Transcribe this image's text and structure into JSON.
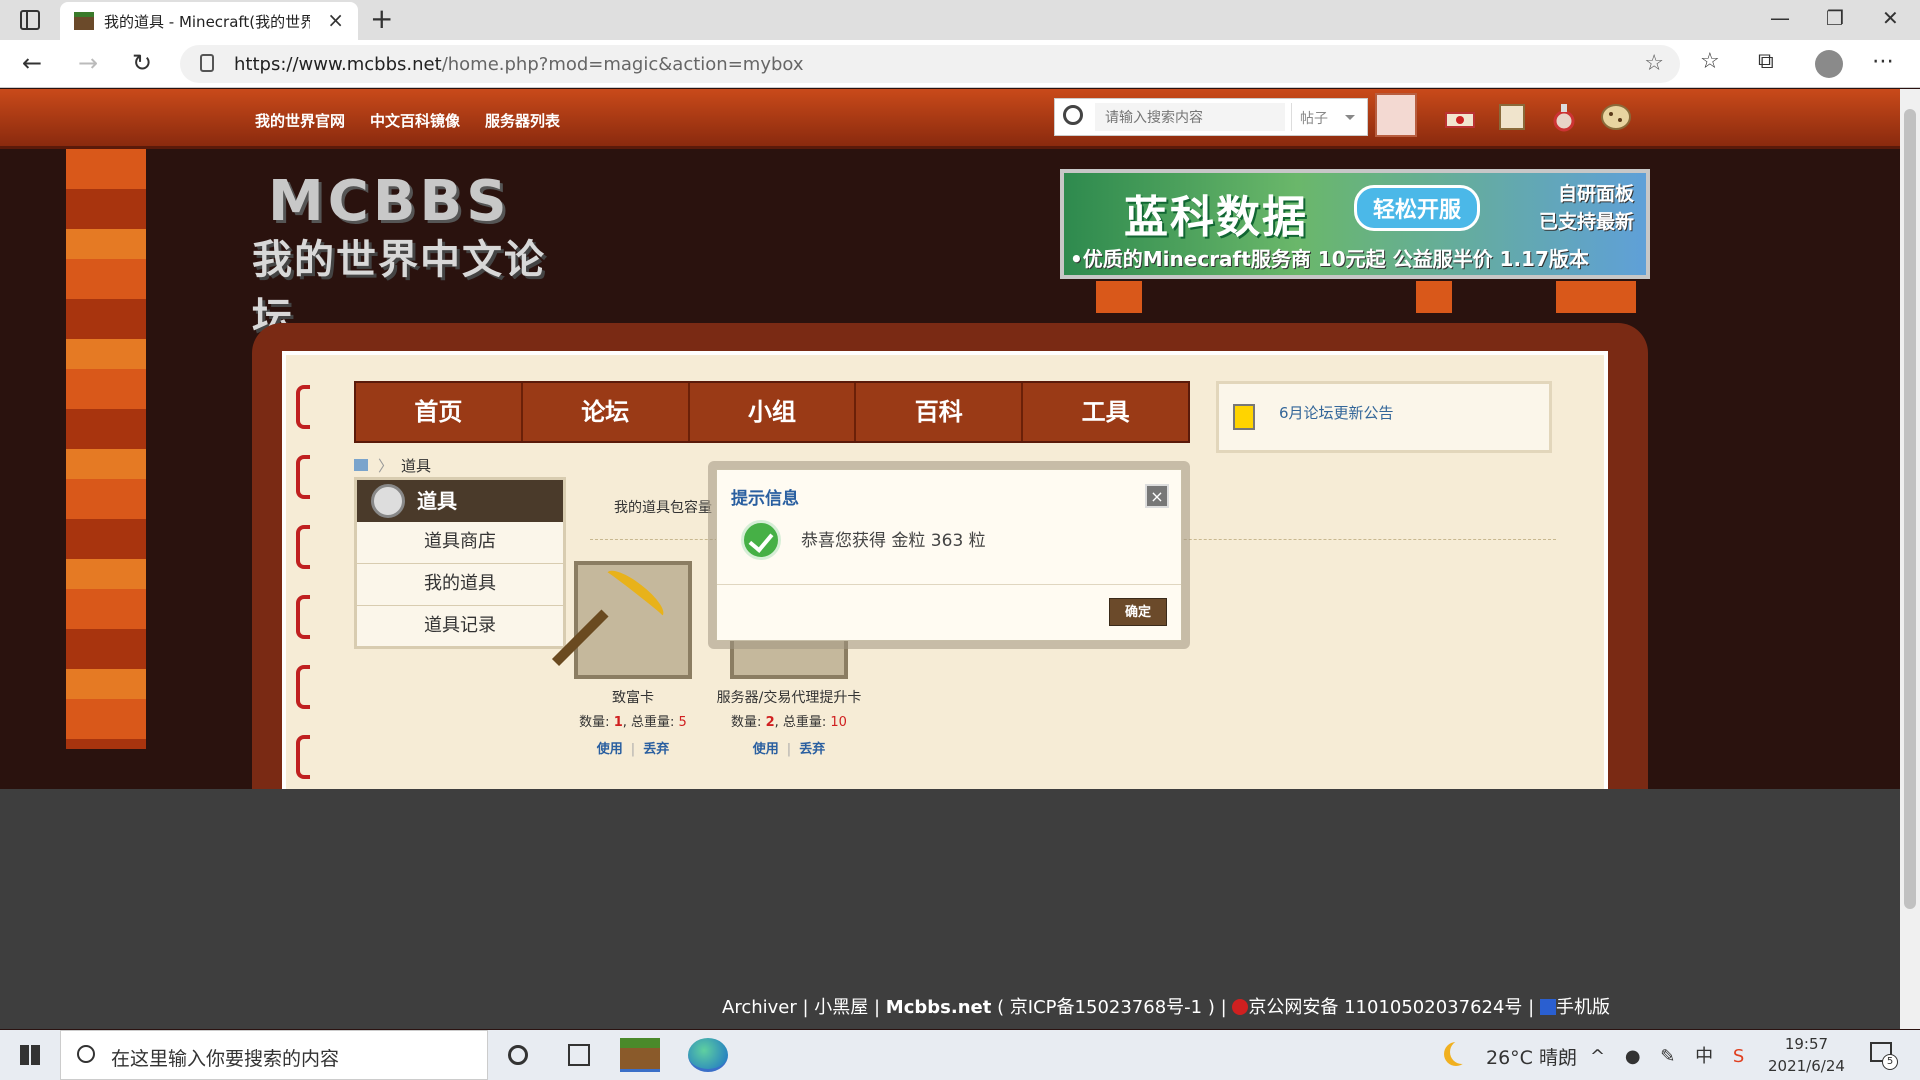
{
  "browser": {
    "tab_title": "我的道具 - Minecraft(我的世界)中",
    "url_host": "https://www.mcbbs.net",
    "url_path": "/home.php?mod=magic&action=mybox"
  },
  "topnav": {
    "links": [
      "我的世界官网",
      "中文百科镜像",
      "服务器列表"
    ],
    "search_placeholder": "请输入搜索内容",
    "search_scope": "帖子"
  },
  "logo": {
    "top": "MCBBS",
    "bottom": "我的世界中文论坛"
  },
  "banner": {
    "main": "蓝科数据",
    "button": "轻松开服",
    "right_line1": "自研面板",
    "right_line2": "已支持最新",
    "sub": "•优质的Minecraft服务商  10元起 公益服半价  1.17版本"
  },
  "mainnav": [
    "首页",
    "论坛",
    "小组",
    "百科",
    "工具"
  ],
  "notice": {
    "text": "6月论坛更新公告"
  },
  "breadcrumb": {
    "current": "道具"
  },
  "sidemenu": {
    "title": "道具",
    "items": [
      "道具商店",
      "我的道具",
      "道具记录"
    ]
  },
  "capacity_label": "我的道具包容量",
  "items": [
    {
      "name": "致富卡",
      "qty_label": "数量:",
      "qty": "1",
      "weight_label": ", 总重量:",
      "weight": "5",
      "use": "使用",
      "discard": "丢弃",
      "icon": "pickaxe-icon"
    },
    {
      "name": "服务器/交易代理提升卡",
      "qty_label": "数量:",
      "qty": "2",
      "weight_label": ", 总重量:",
      "weight": "10",
      "use": "使用",
      "discard": "丢弃",
      "icon": "upgrade-card-icon"
    }
  ],
  "modal": {
    "title": "提示信息",
    "message": "恭喜您获得 金粒 363 粒",
    "ok": "确定",
    "close": "×"
  },
  "footer": {
    "archiver": "Archiver",
    "hut": "小黑屋",
    "site": "Mcbbs.net",
    "icp": "( 京ICP备15023768号-1 )",
    "police": "京公网安备 11010502037624号",
    "mobile": "手机版"
  },
  "taskbar": {
    "search_placeholder": "在这里输入你要搜索的内容",
    "temperature": "26°C",
    "weather": "晴朗",
    "ime": "中",
    "time": "19:57",
    "date": "2021/6/24",
    "notifications": "5"
  },
  "colors": {
    "topnav": "#c94a1a",
    "mainnav": "#9a3a16",
    "panel": "#f6ecd6",
    "link": "#2a5fa0",
    "accent_red": "#d02020"
  }
}
